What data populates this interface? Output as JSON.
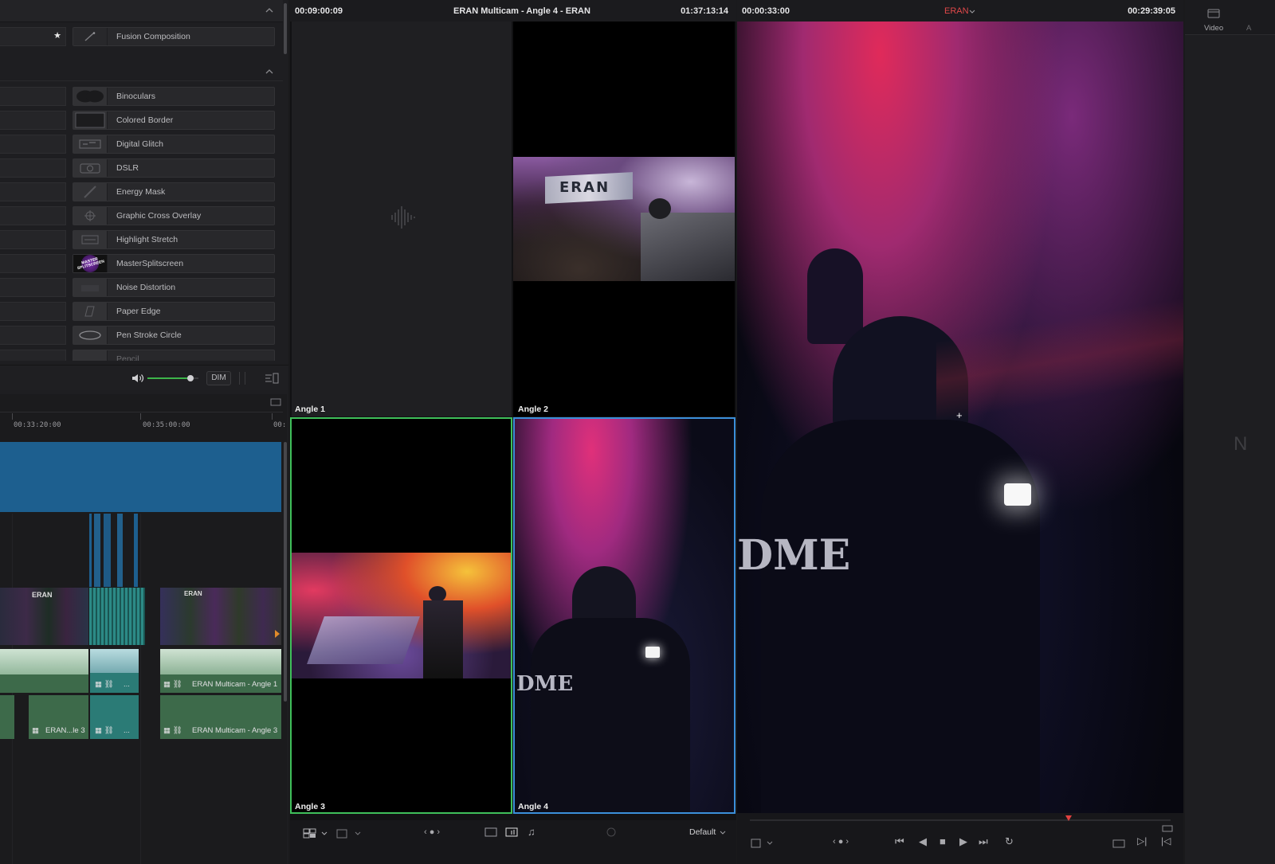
{
  "effects_panel": {
    "fusion_item": "Fusion Composition",
    "items": [
      {
        "label": "Binoculars",
        "icon": "binoculars-icon"
      },
      {
        "label": "Colored Border",
        "icon": "border-icon"
      },
      {
        "label": "Digital Glitch",
        "icon": "glitch-icon"
      },
      {
        "label": "DSLR",
        "icon": "camera-icon"
      },
      {
        "label": "Energy Mask",
        "icon": "mask-icon"
      },
      {
        "label": "Graphic Cross Overlay",
        "icon": "cross-icon"
      },
      {
        "label": "Highlight Stretch",
        "icon": "stretch-icon"
      },
      {
        "label": "MasterSplitscreen",
        "icon": "splitscreen-logo"
      },
      {
        "label": "Noise Distortion",
        "icon": "noise-icon"
      },
      {
        "label": "Paper Edge",
        "icon": "paper-icon"
      },
      {
        "label": "Pen Stroke Circle",
        "icon": "circle-icon"
      },
      {
        "label": "Pencil",
        "icon": "pencil-icon"
      }
    ],
    "thumb_logo_text": "MASTER SPLITSCREEN"
  },
  "audio_controls": {
    "dim_label": "DIM",
    "volume": 0.85
  },
  "timeline": {
    "ruler": [
      "00:33:20:00",
      "00:35:00:00",
      "00:"
    ],
    "clips": {
      "a1_clip": "ERAN Multicam - Angle 1",
      "a2_clip_left": "ERAN...le 3",
      "a2_clip_right": "ERAN Multicam - Angle 3",
      "ellipsis": "..."
    }
  },
  "multicam": {
    "timecode_left": "00:09:00:09",
    "title": "ERAN Multicam - Angle 4 - ERAN",
    "timecode_right": "01:37:13:14",
    "angles": [
      "Angle 1",
      "Angle 2",
      "Angle 3",
      "Angle 4"
    ],
    "layout_mode": "Default",
    "active_video_angle": "Angle 3",
    "active_audio_angle": "Angle 4"
  },
  "program": {
    "timecode_left": "00:00:33:00",
    "clip_name": "ERAN",
    "timecode_right": "00:29:39:05",
    "jacket_text": "DME"
  },
  "right_panel": {
    "tab_label": "Video",
    "next_letter": "A",
    "edge_letter": "N"
  },
  "colors": {
    "active_video_border": "#3fbf5a",
    "active_audio_border": "#3b8fd9",
    "timeline_blue": "#1d5f8f",
    "clip_name_red": "#e0484a"
  }
}
